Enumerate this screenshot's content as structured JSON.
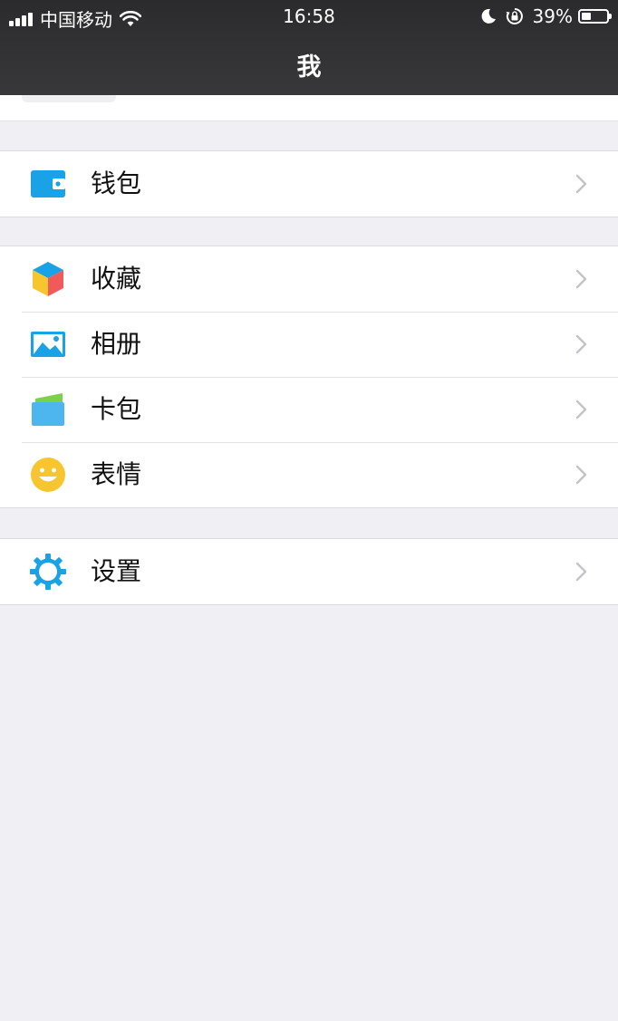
{
  "status_bar": {
    "carrier": "中国移动",
    "time": "16:58",
    "battery": "39%",
    "battery_level": 0.39,
    "icons": [
      "signal-icon",
      "wifi-icon",
      "moon-icon",
      "rotation-lock-icon",
      "battery-icon"
    ]
  },
  "nav": {
    "title": "我"
  },
  "groups": [
    {
      "items": [
        {
          "label": "钱包",
          "icon": "wallet-icon"
        }
      ]
    },
    {
      "items": [
        {
          "label": "收藏",
          "icon": "favorites-cube-icon"
        },
        {
          "label": "相册",
          "icon": "album-icon"
        },
        {
          "label": "卡包",
          "icon": "card-wallet-icon"
        },
        {
          "label": "表情",
          "icon": "sticker-smiley-icon"
        }
      ]
    },
    {
      "items": [
        {
          "label": "设置",
          "icon": "settings-gear-icon"
        }
      ]
    }
  ],
  "colors": {
    "nav_bg": "#2e2e30",
    "page_bg": "#efeff4",
    "accent_blue": "#1aa2e6"
  }
}
